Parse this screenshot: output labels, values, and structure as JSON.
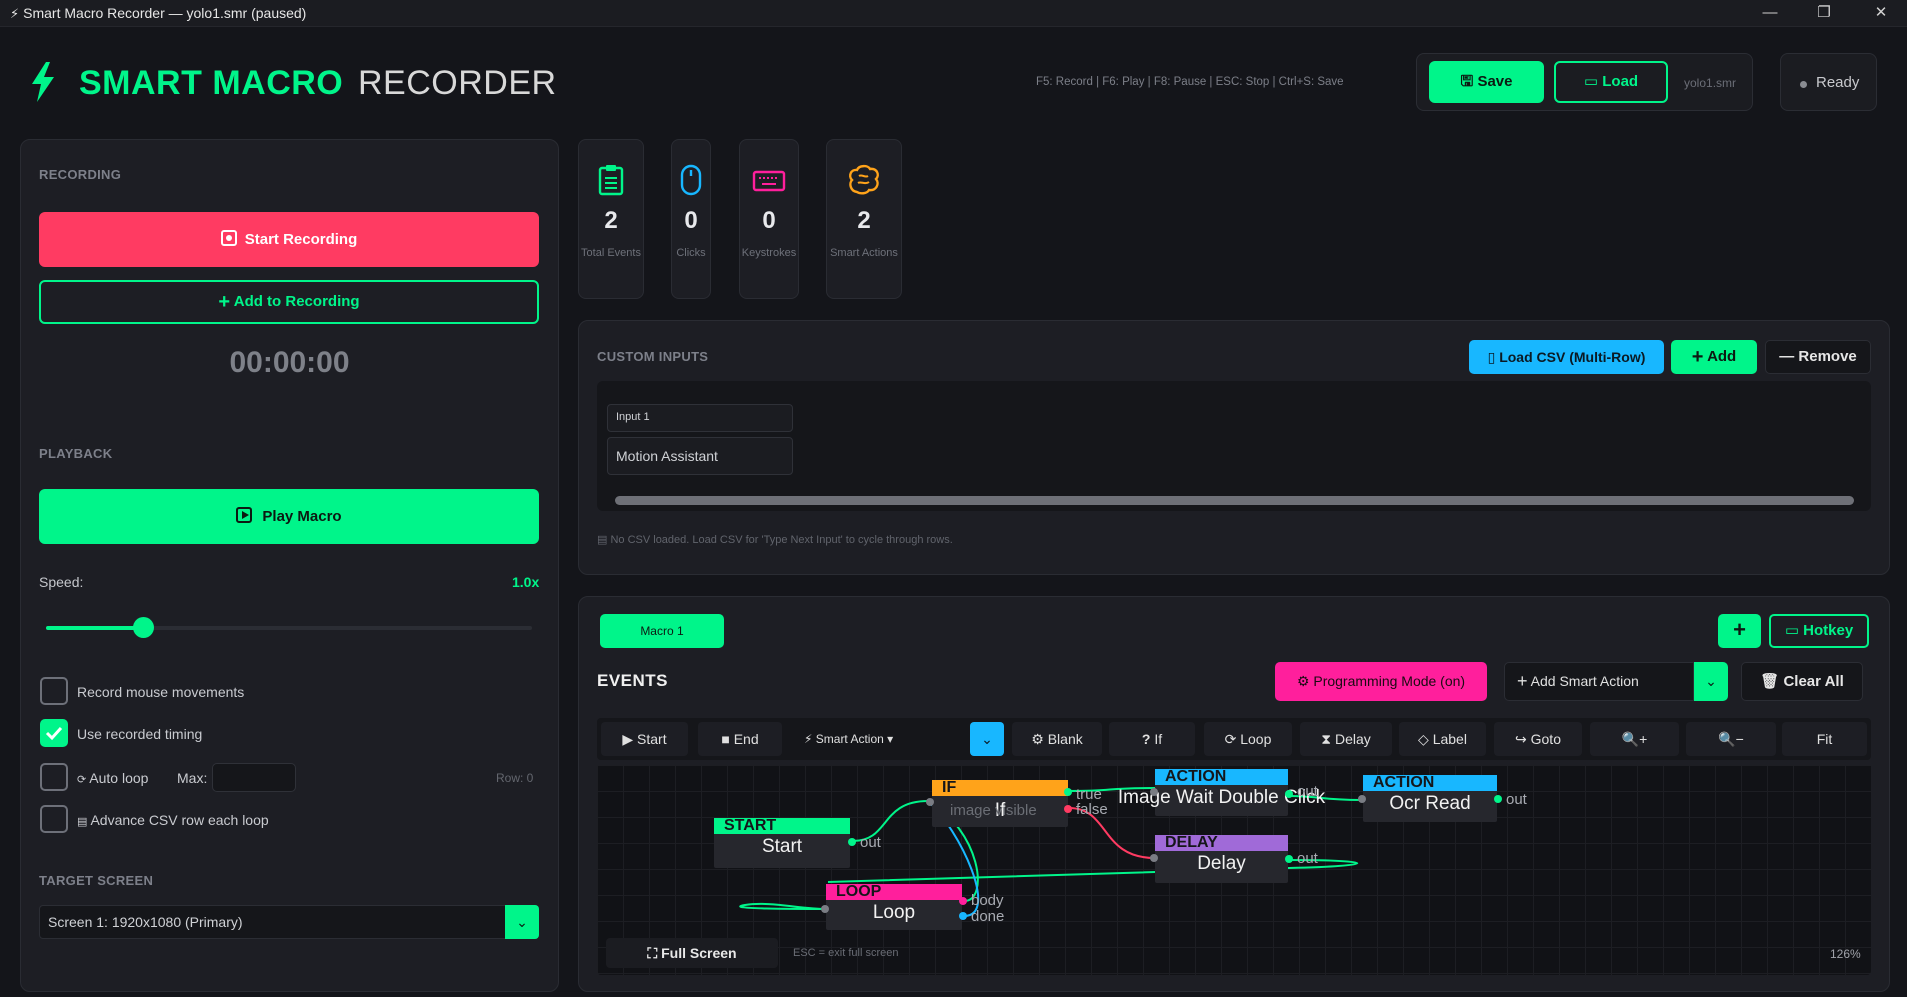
{
  "window": {
    "title": "Smart Macro Recorder — yolo1.smr  (paused)",
    "minimize": "—",
    "restore": "❐",
    "close": "✕"
  },
  "header": {
    "logo_primary": "SMART MACRO",
    "logo_secondary": "RECORDER",
    "hotkeys": "F5: Record  |  F6: Play  |  F8: Pause  |  ESC: Stop  |  Ctrl+S: Save",
    "save_label": "Save",
    "load_label": "Load",
    "file_name": "yolo1.smr",
    "status": "Ready"
  },
  "recording": {
    "section": "RECORDING",
    "start_label": "Start Recording",
    "add_label": "Add to Recording",
    "timer": "00:00:00"
  },
  "playback": {
    "section": "PLAYBACK",
    "play_label": "Play Macro",
    "speed_label": "Speed:",
    "speed_value": "1.0x",
    "speed_fraction": 0.2,
    "options": [
      {
        "label": "Record mouse movements",
        "checked": false
      },
      {
        "label": "Use recorded timing",
        "checked": true
      },
      {
        "label": "Auto loop",
        "checked": false
      },
      {
        "label": "Advance CSV row each loop",
        "checked": false
      }
    ],
    "max_label": "Max:",
    "row_label": "Row: 0"
  },
  "target": {
    "section": "TARGET SCREEN",
    "selected": "Screen 1: 1920x1080 (Primary)"
  },
  "stats": [
    {
      "value": "2",
      "label": "Total Events",
      "icon": "clipboard-icon",
      "color": "#00f58a"
    },
    {
      "value": "0",
      "label": "Clicks",
      "icon": "mouse-icon",
      "color": "#18b7ff"
    },
    {
      "value": "0",
      "label": "Keystrokes",
      "icon": "keyboard-icon",
      "color": "#ff1f9c"
    },
    {
      "value": "2",
      "label": "Smart Actions",
      "icon": "brain-icon",
      "color": "#ffa31a"
    }
  ],
  "custom_inputs": {
    "section": "CUSTOM INPUTS",
    "load_csv_label": "Load CSV (Multi-Row)",
    "add_label": "Add",
    "remove_label": "Remove",
    "input_name": "Input 1",
    "input_value": "Motion Assistant",
    "note": "No CSV loaded. Load CSV for 'Type Next Input' to cycle through rows."
  },
  "events": {
    "macro_tab": "Macro 1",
    "plus_label": "+",
    "hotkey_label": "Hotkey",
    "title": "EVENTS",
    "programming_mode": "Programming Mode (on)",
    "add_smart_action": "Add Smart Action",
    "clear_all": "Clear All",
    "toolbar": {
      "start": "Start",
      "end": "End",
      "smart_action": "Smart Action ▾",
      "blank": "Blank",
      "if": "If",
      "loop": "Loop",
      "delay": "Delay",
      "label": "Label",
      "goto": "Goto",
      "zoom_in": "+",
      "zoom_out": "−",
      "fit": "Fit"
    },
    "full_screen": "Full Screen",
    "full_screen_note": "ESC = exit full screen",
    "zoom": "126%"
  },
  "nodes": {
    "start": {
      "head": "START",
      "body": "Start",
      "out": "out"
    },
    "if": {
      "head": "IF",
      "body": "If",
      "sub": "image visible",
      "true": "true",
      "false": "false"
    },
    "action1": {
      "head": "ACTION",
      "body": "Image Wait Double Click",
      "out": "out"
    },
    "action2": {
      "head": "ACTION",
      "body": "Ocr Read",
      "out": "out"
    },
    "delay": {
      "head": "DELAY",
      "body": "Delay",
      "out": "out"
    },
    "loop": {
      "head": "LOOP",
      "body": "Loop",
      "body_port": "body",
      "done_port": "done"
    }
  },
  "colors": {
    "accent": "#00f58a",
    "record": "#ff3b62",
    "info": "#18b7ff",
    "magenta": "#ff1f9c",
    "if": "#ffa31a",
    "delay": "#a06ad8"
  }
}
